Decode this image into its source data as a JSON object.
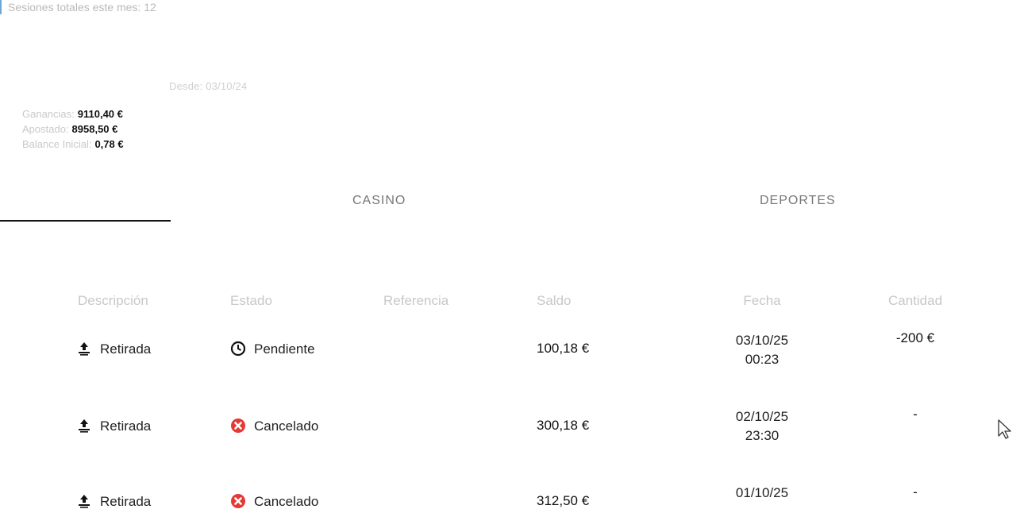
{
  "header": {
    "sessions_text": "Sesiones totales este mes: 12"
  },
  "summary": {
    "since": "Desde: 03/10/24",
    "ganancias_label": "Ganancias:",
    "ganancias_value": "9110,40 €",
    "apostado_label": "Apostado:",
    "apostado_value": "8958,50 €",
    "balance_label": "Balance Inicial:",
    "balance_value": "0,78 €"
  },
  "tabs": [
    {
      "label": "CASINO"
    },
    {
      "label": "DEPORTES"
    }
  ],
  "table": {
    "columns": [
      "Descripción",
      "Estado",
      "Referencia",
      "Saldo",
      "Fecha",
      "Cantidad"
    ],
    "rows": [
      {
        "descripcion": "Retirada",
        "estado": "Pendiente",
        "estado_icon": "clock-icon",
        "referencia": "",
        "saldo": "100,18 €",
        "fecha": "03/10/25",
        "hora": "00:23",
        "cantidad": "-200 €"
      },
      {
        "descripcion": "Retirada",
        "estado": "Cancelado",
        "estado_icon": "cancel-icon",
        "referencia": "",
        "saldo": "300,18 €",
        "fecha": "02/10/25",
        "hora": "23:30",
        "cantidad": "-"
      },
      {
        "descripcion": "Retirada",
        "estado": "Cancelado",
        "estado_icon": "cancel-icon",
        "referencia": "",
        "saldo": "312,50 €",
        "fecha": "01/10/25",
        "hora": "",
        "cantidad": "-"
      }
    ]
  },
  "colors": {
    "accent_border": "#6fa6d6",
    "cancel_red": "#e53935"
  }
}
